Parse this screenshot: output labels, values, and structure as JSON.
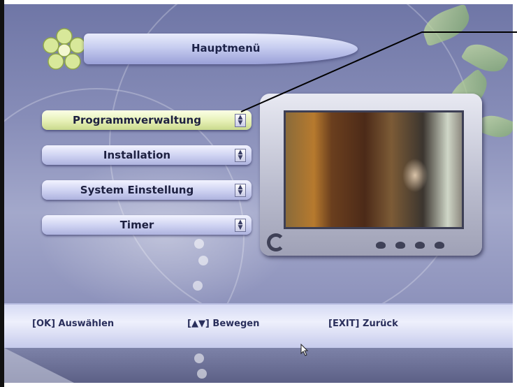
{
  "header": {
    "title": "Hauptmenü"
  },
  "menu": {
    "items": [
      {
        "label": "Programmverwaltung",
        "active": true
      },
      {
        "label": "Installation",
        "active": false
      },
      {
        "label": "System Einstellung",
        "active": false
      },
      {
        "label": "Timer",
        "active": false
      }
    ]
  },
  "help": {
    "ok": "[OK] Auswählen",
    "move": "[▲▼] Bewegen",
    "exit": "[EXIT] Zurück"
  },
  "icons": {
    "logo": "flower-logo-icon",
    "updown": "up-down-arrow-icon",
    "cursor": "mouse-pointer-icon"
  },
  "colors": {
    "background": "#878db8",
    "menu_item": "#cdd1f1",
    "menu_item_active": "#e6f0b6",
    "text": "#1d2040"
  }
}
